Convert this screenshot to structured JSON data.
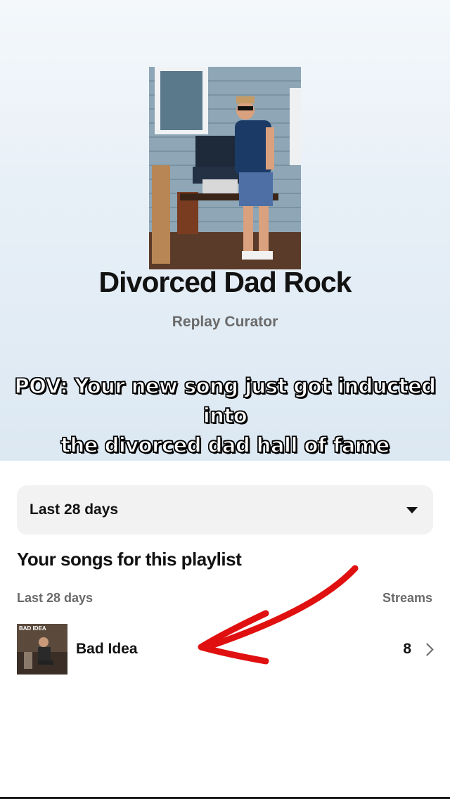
{
  "playlist": {
    "title": "Divorced Dad Rock",
    "subtitle": "Replay Curator"
  },
  "overlay": {
    "caption_line1": "POV: Your new song just got inducted into",
    "caption_line2": "the divorced dad hall of fame"
  },
  "period_select": {
    "selected": "Last 28 days",
    "icon": "caret-down-icon"
  },
  "songs_section": {
    "title": "Your songs for this playlist",
    "col_left": "Last 28 days",
    "col_right": "Streams",
    "rows": [
      {
        "name": "Bad Idea",
        "art_text": "BAD IDEA",
        "streams": "8"
      }
    ]
  },
  "colors": {
    "annotation_arrow": "#e01010",
    "secondary_text": "#6a6a6a",
    "select_bg": "#f2f2f2"
  }
}
